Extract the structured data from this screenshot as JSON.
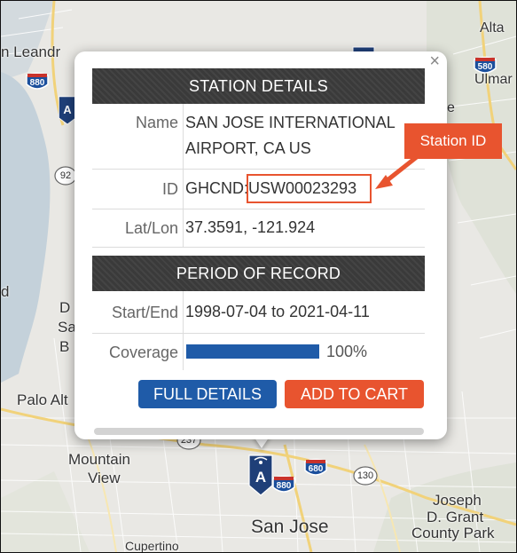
{
  "map": {
    "labels": {
      "san_leandro": "n Leandr",
      "alta": "Alta",
      "ulmar": "Ulmar",
      "e": "e",
      "palo_alto": "Palo Alt",
      "mountain_view_1": "Mountain",
      "mountain_view_2": "View",
      "san_jose": "San Jose",
      "joseph_1": "Joseph",
      "joseph_2": "D. Grant",
      "joseph_3": "County Park",
      "cupertino": "Cupertino",
      "d": "D",
      "sa": "Sa",
      "b": "B",
      "edge_d": "d"
    },
    "shields": {
      "i880_top": "880",
      "i580": "580",
      "r92": "92",
      "r237": "237",
      "i680": "680",
      "r130": "130",
      "i880_bottom": "880"
    }
  },
  "popup": {
    "close_label": "×",
    "station_header": "STATION DETAILS",
    "name_label": "Name",
    "name_value_line1": "SAN JOSE INTERNATIONAL",
    "name_value_line2": "AIRPORT, CA US",
    "id_label": "ID",
    "id_prefix": "GHCND:",
    "id_value": "USW00023293",
    "latlon_label": "Lat/Lon",
    "latlon_value": "37.3591, -121.924",
    "period_header": "PERIOD OF RECORD",
    "startend_label": "Start/End",
    "startend_value": "1998-07-04 to 2021-04-11",
    "coverage_label": "Coverage",
    "coverage_percent_text": "100%",
    "coverage_fraction": 1.0,
    "full_details_label": "FULL DETAILS",
    "add_to_cart_label": "ADD TO CART"
  },
  "annotation": {
    "callout_text": "Station ID",
    "color": "#e8542f"
  },
  "colors": {
    "header_bg": "#3a3a3a",
    "primary_button": "#1f5ba8",
    "cart_button": "#e8542f",
    "coverage_bar": "#1f5ba8"
  }
}
